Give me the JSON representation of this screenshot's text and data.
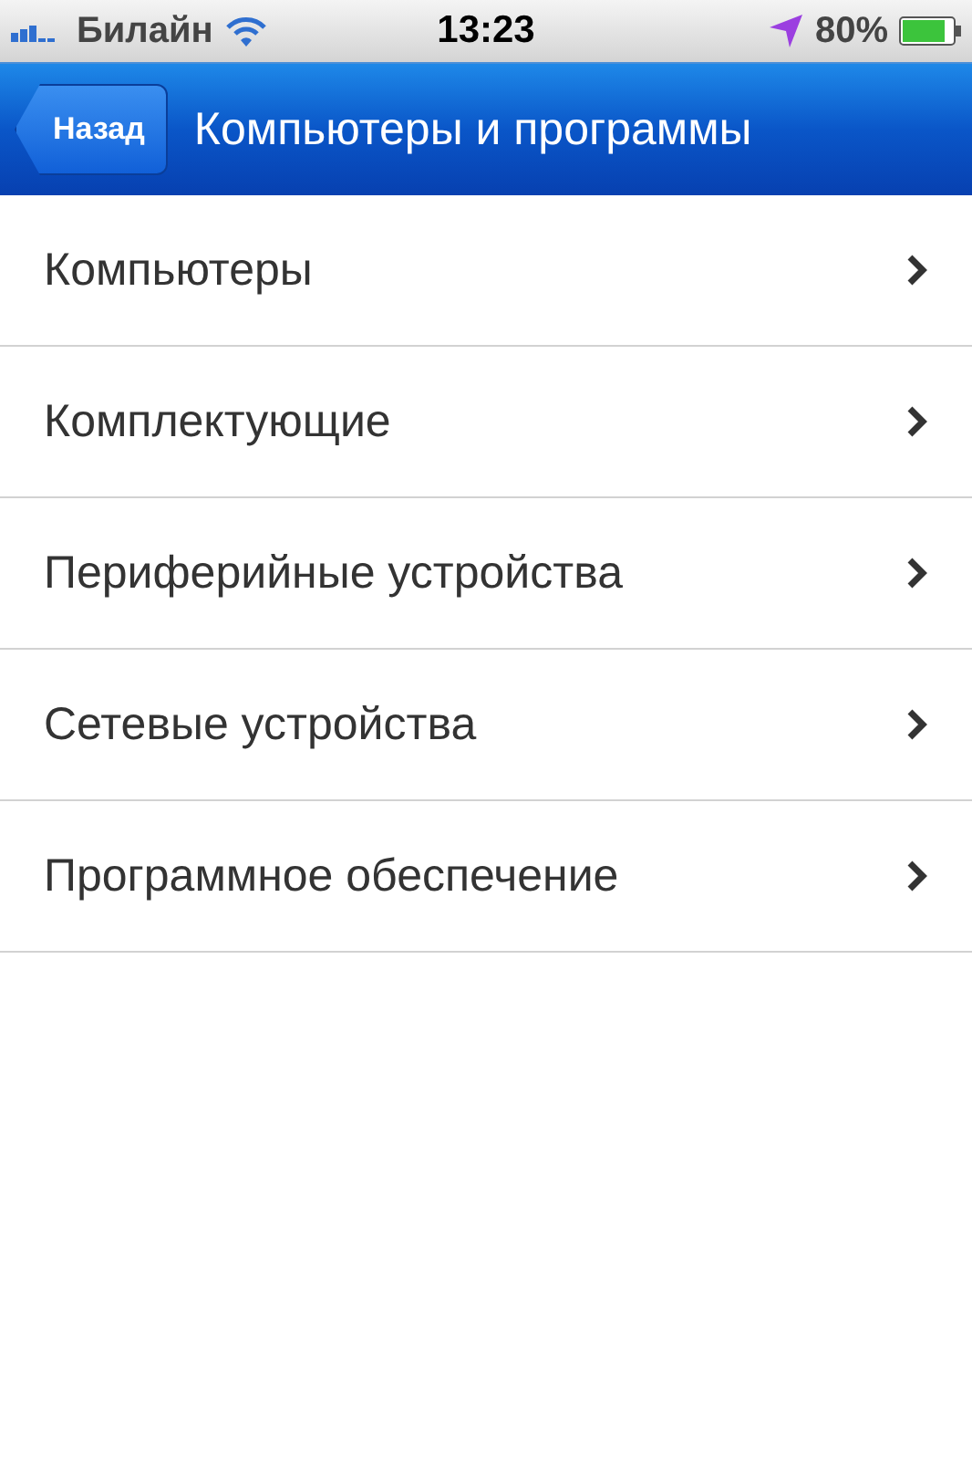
{
  "status_bar": {
    "carrier": "Билайн",
    "time": "13:23",
    "battery": "80%"
  },
  "nav_bar": {
    "back": "Назад",
    "title": "Компьютеры и программы"
  },
  "items": [
    {
      "label": "Компьютеры"
    },
    {
      "label": "Комплектующие"
    },
    {
      "label": "Периферийные устройства"
    },
    {
      "label": "Сетевые устройства"
    },
    {
      "label": "Программное обеспечение"
    }
  ]
}
